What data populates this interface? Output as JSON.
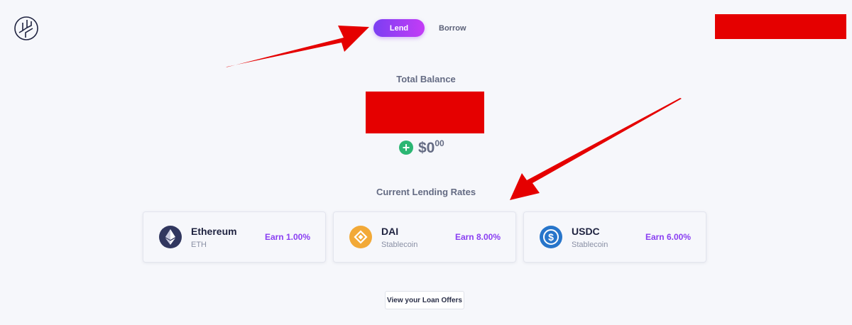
{
  "header": {
    "logo_icon": "app-logo-icon",
    "toggle": {
      "active": "Lend",
      "lend_label": "Lend",
      "borrow_label": "Borrow"
    }
  },
  "balance": {
    "label": "Total Balance",
    "amount": "$0",
    "cents": "00",
    "add_icon": "plus-circle-icon"
  },
  "rates": {
    "label": "Current Lending Rates",
    "items": [
      {
        "name": "Ethereum",
        "sub": "ETH",
        "earn": "Earn 1.00%",
        "icon": "ethereum-icon",
        "color": "#31375f"
      },
      {
        "name": "DAI",
        "sub": "Stablecoin",
        "earn": "Earn 8.00%",
        "icon": "dai-icon",
        "color": "#f2a937"
      },
      {
        "name": "USDC",
        "sub": "Stablecoin",
        "earn": "Earn 6.00%",
        "icon": "usdc-icon",
        "color": "#2775ca"
      }
    ]
  },
  "offers_button": "View your Loan Offers",
  "colors": {
    "accent_gradient_start": "#7b3ff2",
    "accent_gradient_end": "#c43cf6",
    "earn_text": "#8a3ff2",
    "annotation_red": "#e50000",
    "background": "#f6f7fb"
  }
}
